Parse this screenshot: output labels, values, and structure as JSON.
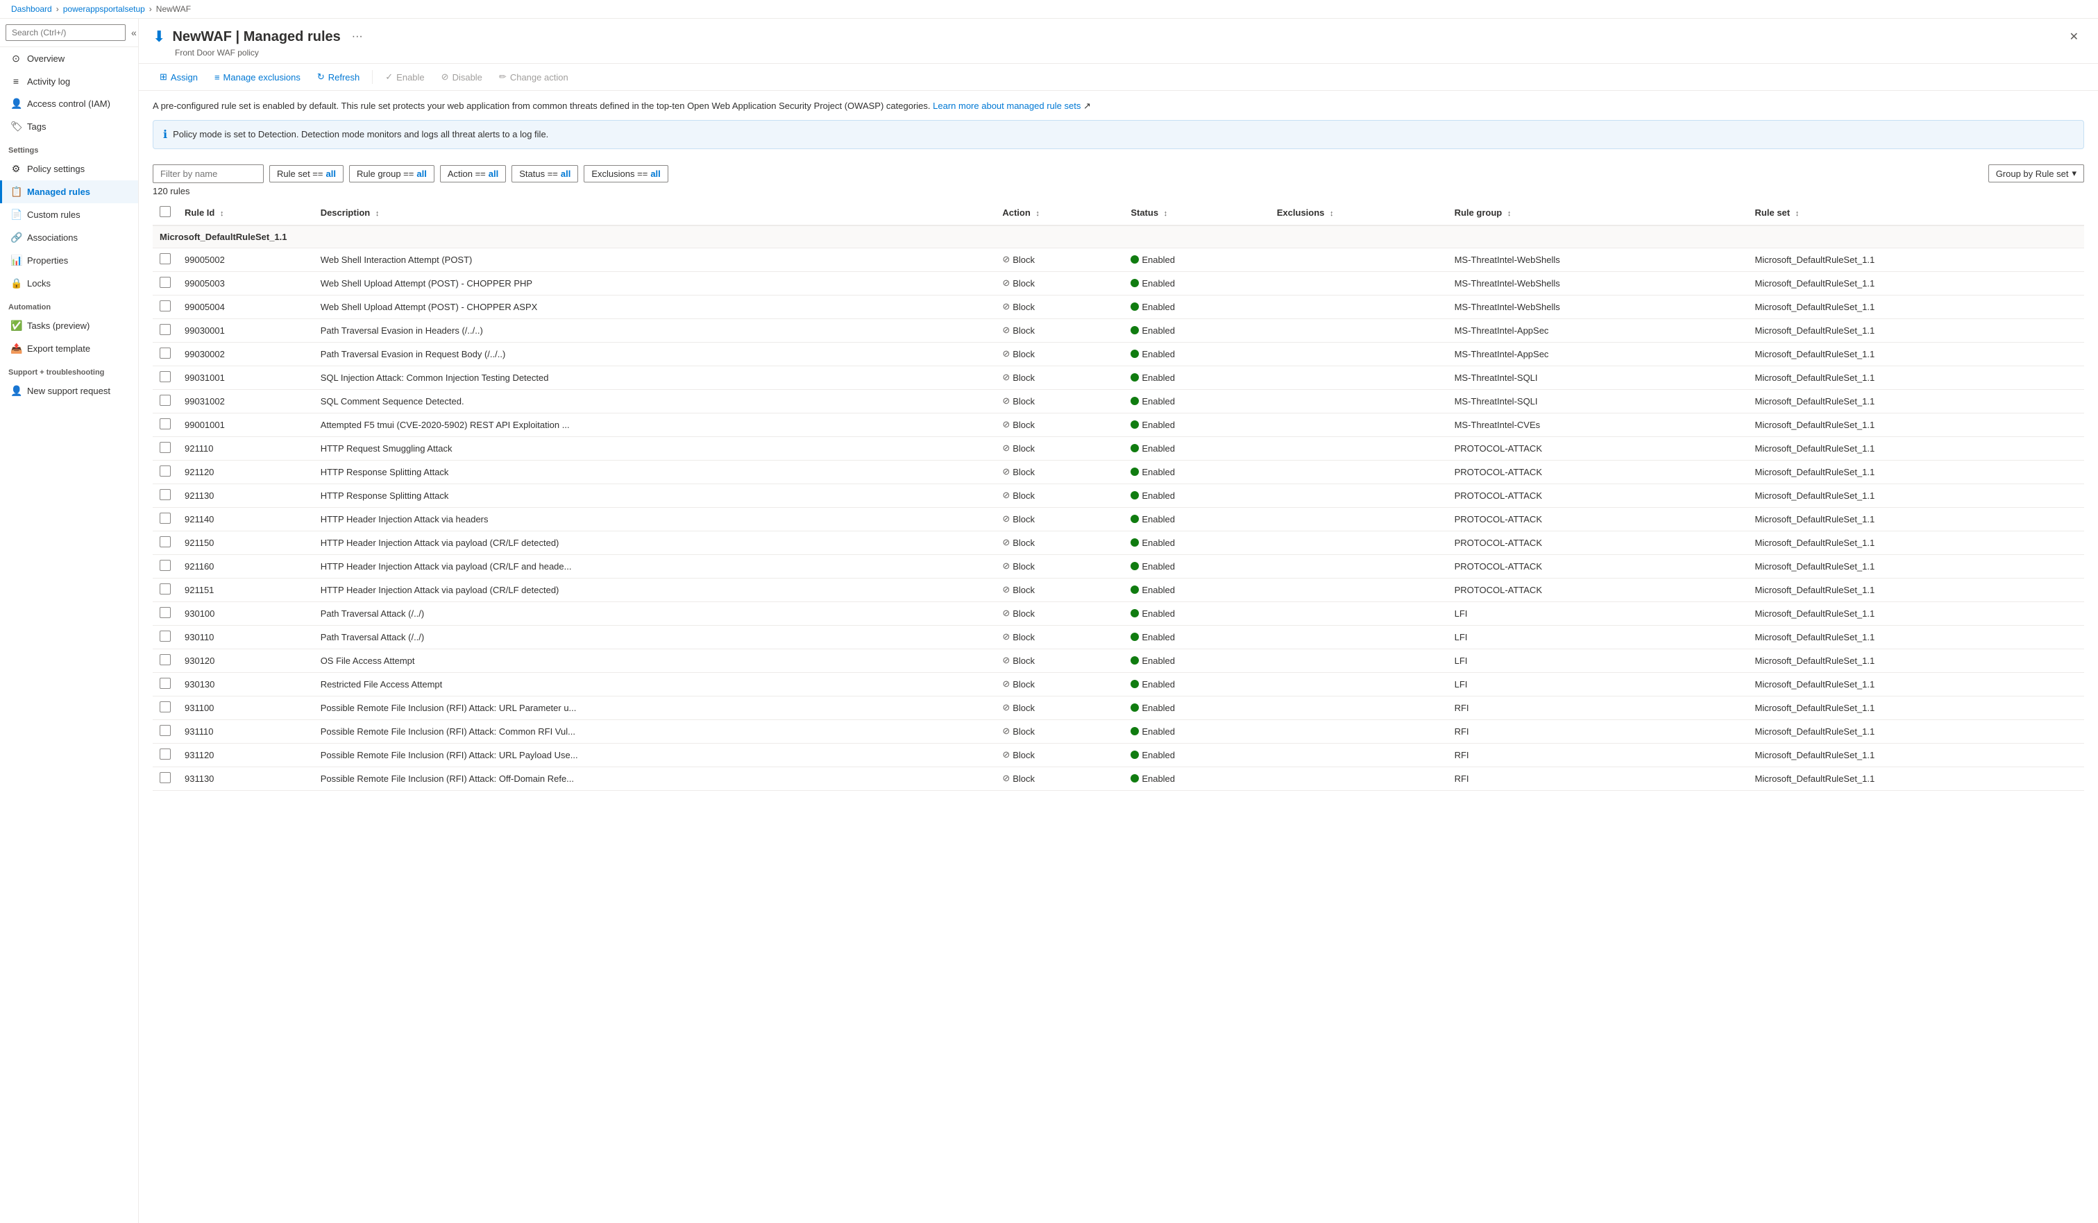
{
  "breadcrumb": {
    "items": [
      "Dashboard",
      "powerappsportalsetup",
      "NewWAF"
    ]
  },
  "header": {
    "icon": "⬇",
    "title": "NewWAF | Managed rules",
    "subtitle": "Front Door WAF policy",
    "ellipsis": "···",
    "close": "✕"
  },
  "sidebar": {
    "search_placeholder": "Search (Ctrl+/)",
    "items": [
      {
        "id": "overview",
        "label": "Overview",
        "icon": "⊙",
        "active": false
      },
      {
        "id": "activity-log",
        "label": "Activity log",
        "icon": "≡",
        "active": false
      },
      {
        "id": "access-control",
        "label": "Access control (IAM)",
        "icon": "👤",
        "active": false
      },
      {
        "id": "tags",
        "label": "Tags",
        "icon": "🏷",
        "active": false
      }
    ],
    "sections": [
      {
        "label": "Settings",
        "items": [
          {
            "id": "policy-settings",
            "label": "Policy settings",
            "icon": "⚙",
            "active": false
          },
          {
            "id": "managed-rules",
            "label": "Managed rules",
            "icon": "📋",
            "active": true
          },
          {
            "id": "custom-rules",
            "label": "Custom rules",
            "icon": "📄",
            "active": false
          },
          {
            "id": "associations",
            "label": "Associations",
            "icon": "🔗",
            "active": false
          },
          {
            "id": "properties",
            "label": "Properties",
            "icon": "📊",
            "active": false
          },
          {
            "id": "locks",
            "label": "Locks",
            "icon": "🔒",
            "active": false
          }
        ]
      },
      {
        "label": "Automation",
        "items": [
          {
            "id": "tasks",
            "label": "Tasks (preview)",
            "icon": "✅",
            "active": false
          },
          {
            "id": "export-template",
            "label": "Export template",
            "icon": "📤",
            "active": false
          }
        ]
      },
      {
        "label": "Support + troubleshooting",
        "items": [
          {
            "id": "new-support",
            "label": "New support request",
            "icon": "👤",
            "active": false
          }
        ]
      }
    ]
  },
  "toolbar": {
    "buttons": [
      {
        "id": "assign",
        "label": "Assign",
        "icon": "⊞",
        "disabled": false
      },
      {
        "id": "manage-exclusions",
        "label": "Manage exclusions",
        "icon": "≡",
        "disabled": false
      },
      {
        "id": "refresh",
        "label": "Refresh",
        "icon": "↻",
        "disabled": false
      },
      {
        "id": "enable",
        "label": "Enable",
        "icon": "✓",
        "disabled": true
      },
      {
        "id": "disable",
        "label": "Disable",
        "icon": "⊘",
        "disabled": true
      },
      {
        "id": "change-action",
        "label": "Change action",
        "icon": "✏",
        "disabled": true
      }
    ]
  },
  "info": {
    "description": "A pre-configured rule set is enabled by default. This rule set protects your web application from common threats defined in the top-ten Open Web Application Security Project (OWASP) categories.",
    "link_text": "Learn more about managed rule sets",
    "notice": "Policy mode is set to Detection. Detection mode monitors and logs all threat alerts to a log file."
  },
  "filters": {
    "name_placeholder": "Filter by name",
    "pills": [
      {
        "key": "Rule set ==",
        "value": "all"
      },
      {
        "key": "Rule group ==",
        "value": "all"
      },
      {
        "key": "Action ==",
        "value": "all"
      },
      {
        "key": "Status ==",
        "value": "all"
      },
      {
        "key": "Exclusions ==",
        "value": "all"
      }
    ],
    "group_by": "Group by Rule set"
  },
  "rule_count": "120 rules",
  "table": {
    "columns": [
      {
        "id": "rule-id",
        "label": "Rule Id",
        "sortable": true
      },
      {
        "id": "description",
        "label": "Description",
        "sortable": true
      },
      {
        "id": "action",
        "label": "Action",
        "sortable": true
      },
      {
        "id": "status",
        "label": "Status",
        "sortable": true
      },
      {
        "id": "exclusions",
        "label": "Exclusions",
        "sortable": true
      },
      {
        "id": "rule-group",
        "label": "Rule group",
        "sortable": true
      },
      {
        "id": "rule-set",
        "label": "Rule set",
        "sortable": true
      }
    ],
    "groups": [
      {
        "group_name": "Microsoft_DefaultRuleSet_1.1",
        "rows": [
          {
            "id": "99005002",
            "description": "Web Shell Interaction Attempt (POST)",
            "action": "Block",
            "status": "Enabled",
            "exclusions": "",
            "rule_group": "MS-ThreatIntel-WebShells",
            "rule_set": "Microsoft_DefaultRuleSet_1.1"
          },
          {
            "id": "99005003",
            "description": "Web Shell Upload Attempt (POST) - CHOPPER PHP",
            "action": "Block",
            "status": "Enabled",
            "exclusions": "",
            "rule_group": "MS-ThreatIntel-WebShells",
            "rule_set": "Microsoft_DefaultRuleSet_1.1"
          },
          {
            "id": "99005004",
            "description": "Web Shell Upload Attempt (POST) - CHOPPER ASPX",
            "action": "Block",
            "status": "Enabled",
            "exclusions": "",
            "rule_group": "MS-ThreatIntel-WebShells",
            "rule_set": "Microsoft_DefaultRuleSet_1.1"
          },
          {
            "id": "99030001",
            "description": "Path Traversal Evasion in Headers (/../..)",
            "action": "Block",
            "status": "Enabled",
            "exclusions": "",
            "rule_group": "MS-ThreatIntel-AppSec",
            "rule_set": "Microsoft_DefaultRuleSet_1.1"
          },
          {
            "id": "99030002",
            "description": "Path Traversal Evasion in Request Body (/../..)",
            "action": "Block",
            "status": "Enabled",
            "exclusions": "",
            "rule_group": "MS-ThreatIntel-AppSec",
            "rule_set": "Microsoft_DefaultRuleSet_1.1"
          },
          {
            "id": "99031001",
            "description": "SQL Injection Attack: Common Injection Testing Detected",
            "action": "Block",
            "status": "Enabled",
            "exclusions": "",
            "rule_group": "MS-ThreatIntel-SQLI",
            "rule_set": "Microsoft_DefaultRuleSet_1.1"
          },
          {
            "id": "99031002",
            "description": "SQL Comment Sequence Detected.",
            "action": "Block",
            "status": "Enabled",
            "exclusions": "",
            "rule_group": "MS-ThreatIntel-SQLI",
            "rule_set": "Microsoft_DefaultRuleSet_1.1"
          },
          {
            "id": "99001001",
            "description": "Attempted F5 tmui (CVE-2020-5902) REST API Exploitation ...",
            "action": "Block",
            "status": "Enabled",
            "exclusions": "",
            "rule_group": "MS-ThreatIntel-CVEs",
            "rule_set": "Microsoft_DefaultRuleSet_1.1"
          },
          {
            "id": "921110",
            "description": "HTTP Request Smuggling Attack",
            "action": "Block",
            "status": "Enabled",
            "exclusions": "",
            "rule_group": "PROTOCOL-ATTACK",
            "rule_set": "Microsoft_DefaultRuleSet_1.1"
          },
          {
            "id": "921120",
            "description": "HTTP Response Splitting Attack",
            "action": "Block",
            "status": "Enabled",
            "exclusions": "",
            "rule_group": "PROTOCOL-ATTACK",
            "rule_set": "Microsoft_DefaultRuleSet_1.1"
          },
          {
            "id": "921130",
            "description": "HTTP Response Splitting Attack",
            "action": "Block",
            "status": "Enabled",
            "exclusions": "",
            "rule_group": "PROTOCOL-ATTACK",
            "rule_set": "Microsoft_DefaultRuleSet_1.1"
          },
          {
            "id": "921140",
            "description": "HTTP Header Injection Attack via headers",
            "action": "Block",
            "status": "Enabled",
            "exclusions": "",
            "rule_group": "PROTOCOL-ATTACK",
            "rule_set": "Microsoft_DefaultRuleSet_1.1"
          },
          {
            "id": "921150",
            "description": "HTTP Header Injection Attack via payload (CR/LF detected)",
            "action": "Block",
            "status": "Enabled",
            "exclusions": "",
            "rule_group": "PROTOCOL-ATTACK",
            "rule_set": "Microsoft_DefaultRuleSet_1.1"
          },
          {
            "id": "921160",
            "description": "HTTP Header Injection Attack via payload (CR/LF and heade...",
            "action": "Block",
            "status": "Enabled",
            "exclusions": "",
            "rule_group": "PROTOCOL-ATTACK",
            "rule_set": "Microsoft_DefaultRuleSet_1.1"
          },
          {
            "id": "921151",
            "description": "HTTP Header Injection Attack via payload (CR/LF detected)",
            "action": "Block",
            "status": "Enabled",
            "exclusions": "",
            "rule_group": "PROTOCOL-ATTACK",
            "rule_set": "Microsoft_DefaultRuleSet_1.1"
          },
          {
            "id": "930100",
            "description": "Path Traversal Attack (/../)",
            "action": "Block",
            "status": "Enabled",
            "exclusions": "",
            "rule_group": "LFI",
            "rule_set": "Microsoft_DefaultRuleSet_1.1"
          },
          {
            "id": "930110",
            "description": "Path Traversal Attack (/../)",
            "action": "Block",
            "status": "Enabled",
            "exclusions": "",
            "rule_group": "LFI",
            "rule_set": "Microsoft_DefaultRuleSet_1.1"
          },
          {
            "id": "930120",
            "description": "OS File Access Attempt",
            "action": "Block",
            "status": "Enabled",
            "exclusions": "",
            "rule_group": "LFI",
            "rule_set": "Microsoft_DefaultRuleSet_1.1"
          },
          {
            "id": "930130",
            "description": "Restricted File Access Attempt",
            "action": "Block",
            "status": "Enabled",
            "exclusions": "",
            "rule_group": "LFI",
            "rule_set": "Microsoft_DefaultRuleSet_1.1"
          },
          {
            "id": "931100",
            "description": "Possible Remote File Inclusion (RFI) Attack: URL Parameter u...",
            "action": "Block",
            "status": "Enabled",
            "exclusions": "",
            "rule_group": "RFI",
            "rule_set": "Microsoft_DefaultRuleSet_1.1"
          },
          {
            "id": "931110",
            "description": "Possible Remote File Inclusion (RFI) Attack: Common RFI Vul...",
            "action": "Block",
            "status": "Enabled",
            "exclusions": "",
            "rule_group": "RFI",
            "rule_set": "Microsoft_DefaultRuleSet_1.1"
          },
          {
            "id": "931120",
            "description": "Possible Remote File Inclusion (RFI) Attack: URL Payload Use...",
            "action": "Block",
            "status": "Enabled",
            "exclusions": "",
            "rule_group": "RFI",
            "rule_set": "Microsoft_DefaultRuleSet_1.1"
          },
          {
            "id": "931130",
            "description": "Possible Remote File Inclusion (RFI) Attack: Off-Domain Refe...",
            "action": "Block",
            "status": "Enabled",
            "exclusions": "",
            "rule_group": "RFI",
            "rule_set": "Microsoft_DefaultRuleSet_1.1"
          }
        ]
      }
    ]
  }
}
